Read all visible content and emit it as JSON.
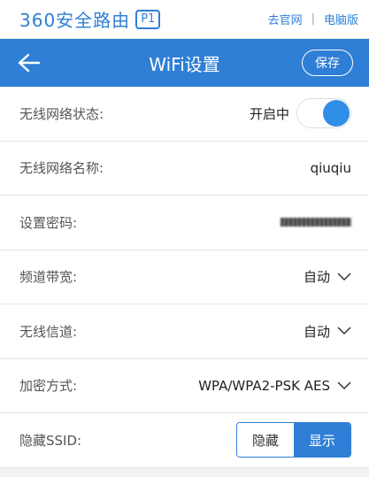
{
  "topbar": {
    "brand": "360安全路由",
    "badge": "P1",
    "link_official": "去官网",
    "separator": "|",
    "link_desktop": "电脑版"
  },
  "header": {
    "title": "WiFi设置",
    "save_label": "保存",
    "back_icon": "arrow-left-icon"
  },
  "rows": {
    "status": {
      "label": "无线网络状态:",
      "value": "开启中",
      "toggle_on": true
    },
    "ssid_name": {
      "label": "无线网络名称:",
      "value": "qiuqiu"
    },
    "password": {
      "label": "设置密码:"
    },
    "bandwidth": {
      "label": "频道带宽:",
      "value": "自动"
    },
    "channel": {
      "label": "无线信道:",
      "value": "自动"
    },
    "encryption": {
      "label": "加密方式:",
      "value": "WPA/WPA2-PSK AES"
    },
    "hide_ssid": {
      "label": "隐藏SSID:",
      "option_hide": "隐藏",
      "option_show": "显示",
      "selected": "显示"
    }
  },
  "colors": {
    "accent": "#2f7fd6",
    "toggle_knob": "#2f8ee8"
  }
}
